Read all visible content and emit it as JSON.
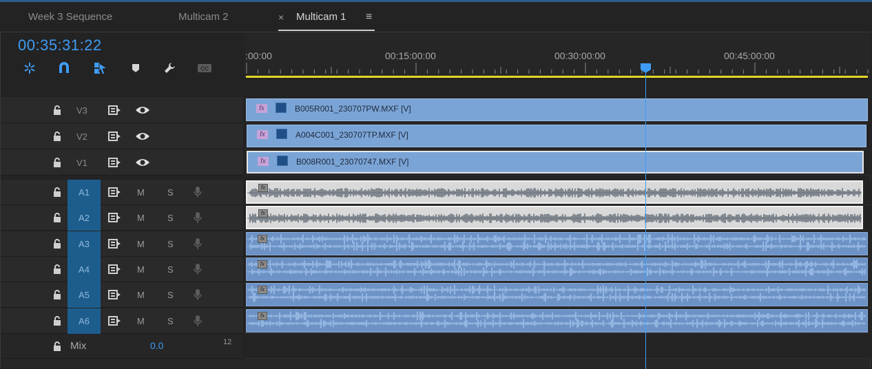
{
  "tabs": [
    {
      "label": "Week 3 Sequence",
      "active": false
    },
    {
      "label": "Multicam 2",
      "active": false
    },
    {
      "label": "Multicam 1",
      "active": true
    }
  ],
  "tab_close_glyph": "×",
  "tab_menu_glyph": "≡",
  "timecode": "00:35:31:22",
  "ruler": {
    "labels": [
      ":00:00",
      "00:15:00:00",
      "00:30:00:00",
      "00:45:00:00"
    ],
    "playhead_time": "00:35:31:22"
  },
  "tools": [
    {
      "name": "snap-icon",
      "label": "Insert and overwrite sequences as nests or individual clips"
    },
    {
      "name": "magnet-icon",
      "label": "Snap"
    },
    {
      "name": "linked-selection-icon",
      "label": "Linked Selection"
    },
    {
      "name": "add-marker-icon",
      "label": "Add Marker"
    },
    {
      "name": "wrench-icon",
      "label": "Timeline Display Settings"
    },
    {
      "name": "captions-icon",
      "label": "CC"
    }
  ],
  "video_tracks": [
    {
      "id": "V3",
      "clip": "B005R001_230707PW.MXF [V]",
      "selected": false
    },
    {
      "id": "V2",
      "clip": "A004C001_230707TP.MXF [V]",
      "selected": false
    },
    {
      "id": "V1",
      "clip": "B008R001_23070747.MXF [V]",
      "selected": true
    }
  ],
  "audio_tracks": [
    {
      "id": "A1",
      "m": "M",
      "s": "S",
      "selected": true
    },
    {
      "id": "A2",
      "m": "M",
      "s": "S",
      "selected": true
    },
    {
      "id": "A3",
      "m": "M",
      "s": "S",
      "selected": false
    },
    {
      "id": "A4",
      "m": "M",
      "s": "S",
      "selected": false
    },
    {
      "id": "A5",
      "m": "M",
      "s": "S",
      "selected": false
    },
    {
      "id": "A6",
      "m": "M",
      "s": "S",
      "selected": false
    }
  ],
  "mix": {
    "label": "Mix",
    "value": "0.0",
    "level": "12"
  },
  "fx_badge": "fx",
  "colors": {
    "accent": "#3f9cf4",
    "work_area": "#e6d52a",
    "video_clip": "#7ba4d6",
    "audio_clip": "#6d93c6",
    "target_track": "#1d5d8e"
  }
}
